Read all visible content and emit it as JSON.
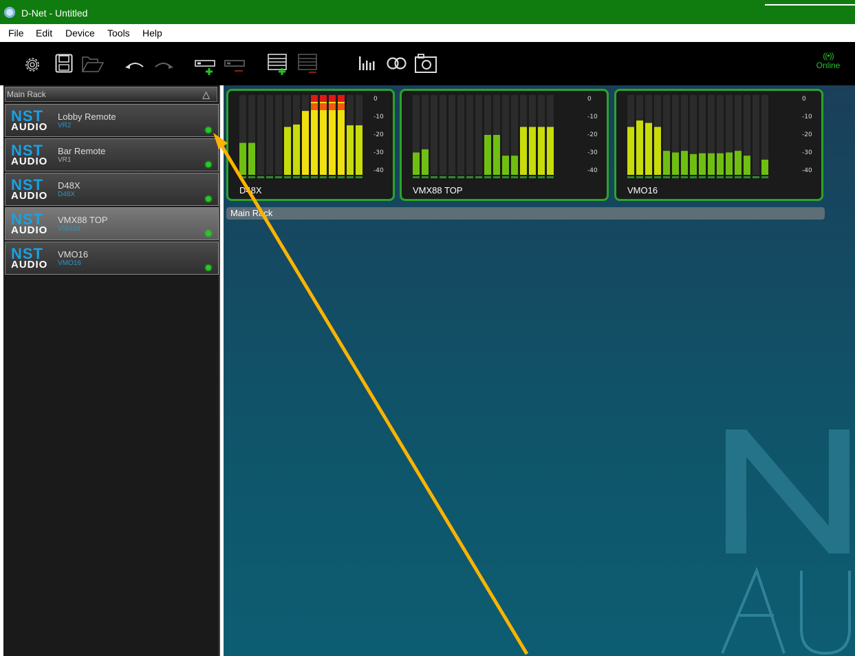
{
  "window": {
    "title": "D-Net - Untitled"
  },
  "menu": [
    "File",
    "Edit",
    "Device",
    "Tools",
    "Help"
  ],
  "status": {
    "online": "Online"
  },
  "rack": {
    "name": "Main Rack",
    "devices": [
      {
        "name": "Lobby Remote",
        "model": "VR2"
      },
      {
        "name": "Bar Remote",
        "model": "VR1"
      },
      {
        "name": "D48X",
        "model": "D48X"
      },
      {
        "name": "VMX88 TOP",
        "model": "VMX88"
      },
      {
        "name": "VMO16",
        "model": "VMO16"
      }
    ]
  },
  "logo": {
    "nst": "NST",
    "audio": "AUDIO"
  },
  "meters": [
    {
      "name": "D48X",
      "scale": [
        "0",
        "-10",
        "-20",
        "-30",
        "-40"
      ],
      "levels": [
        0.4,
        0.4,
        0,
        0,
        0,
        0.6,
        0.63,
        0.8,
        1.0,
        1.0,
        1.0,
        1.0,
        0.62,
        0.62
      ]
    },
    {
      "name": "VMX88 TOP",
      "scale": [
        "0",
        "-10",
        "-20",
        "-30",
        "-40"
      ],
      "levels": [
        0.28,
        0.32,
        0,
        0,
        0,
        0,
        0,
        0,
        0.5,
        0.5,
        0.24,
        0.24,
        0.6,
        0.6,
        0.6,
        0.6
      ]
    },
    {
      "name": "VMO16",
      "scale": [
        "0",
        "-10",
        "-20",
        "-30",
        "-40"
      ],
      "levels": [
        0.6,
        0.68,
        0.65,
        0.6,
        0.3,
        0.28,
        0.3,
        0.26,
        0.27,
        0.27,
        0.27,
        0.28,
        0.3,
        0.24,
        0,
        0.19
      ]
    }
  ],
  "colors": {
    "title_bar": "#107c10",
    "led_green": "#22cc22",
    "accent_blue": "#1aa1e2",
    "meter_border": "#2aa52a",
    "arrow": "#ffb300"
  },
  "icons": [
    "settings-gear-icon",
    "save-icon",
    "open-folder-icon",
    "undo-icon",
    "redo-icon",
    "add-device-icon",
    "remove-device-icon",
    "add-rack-icon",
    "remove-rack-icon",
    "meters-icon",
    "link-icon",
    "snapshot-icon",
    "online-signal-icon"
  ]
}
